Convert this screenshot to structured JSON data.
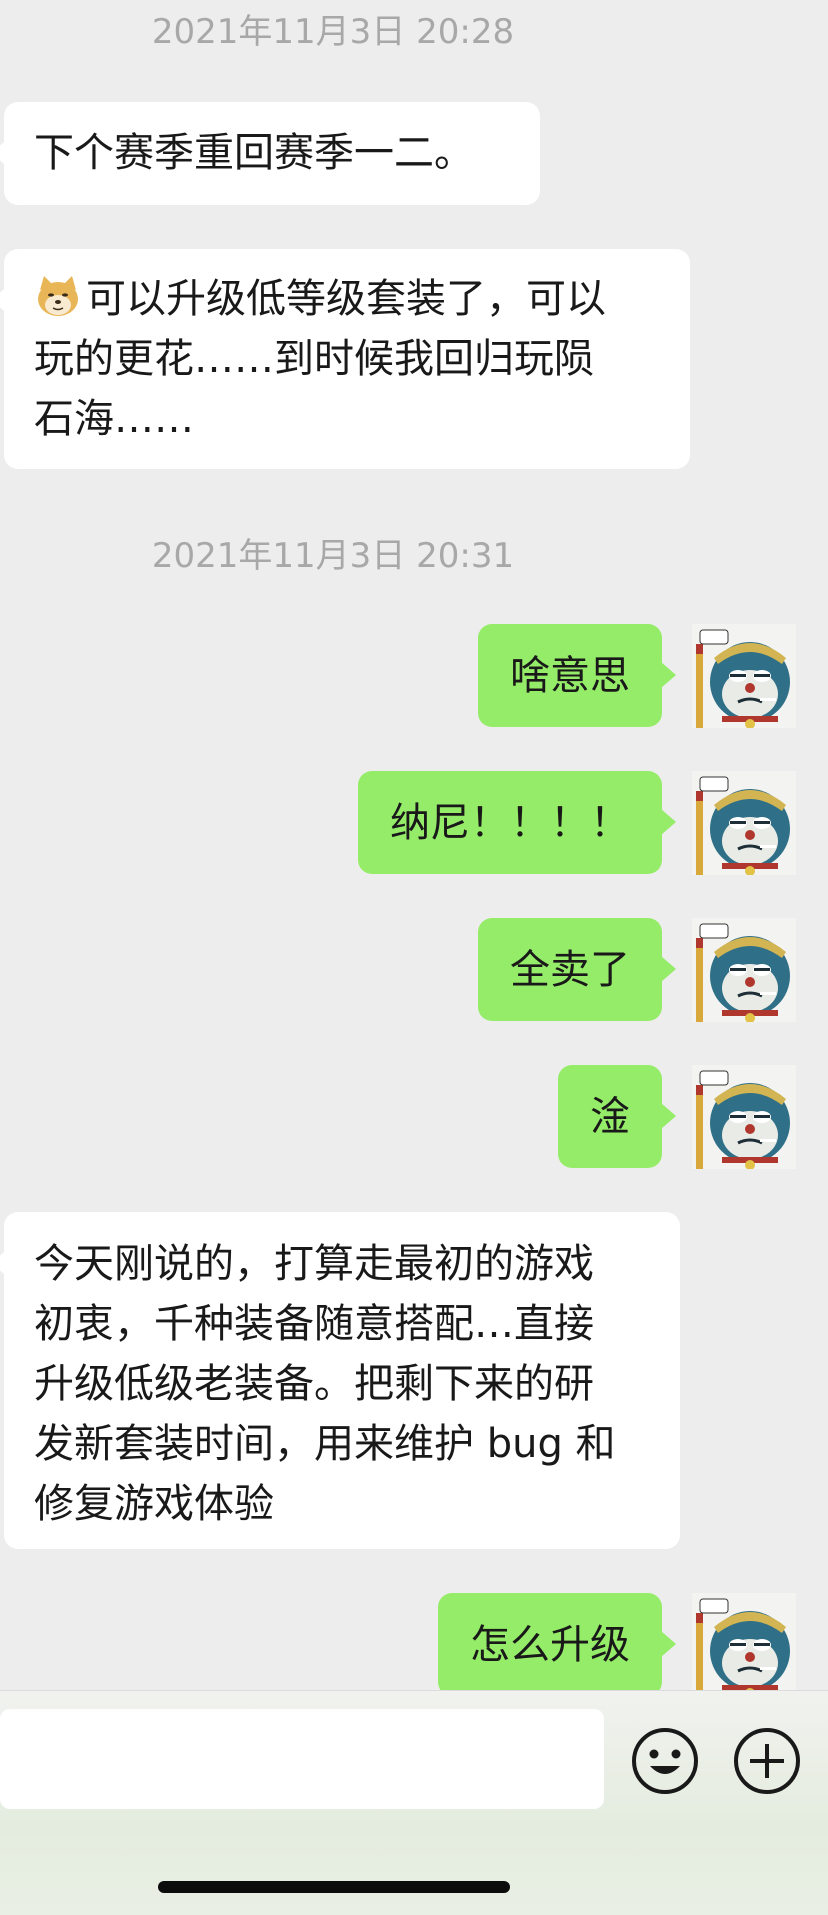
{
  "timestamps": [
    "2021年11月3日 20:28",
    "2021年11月3日 20:31"
  ],
  "messages": [
    {
      "side": "in",
      "text": "下个赛季重回赛季一二。"
    },
    {
      "side": "in",
      "emoji": "doge-emoji",
      "lines": [
        "可以升级低等级套装了，可以",
        "玩的更花……到时候我回归玩陨",
        "石海……"
      ]
    },
    {
      "side": "out",
      "text": "啥意思"
    },
    {
      "side": "out",
      "text": "纳尼！！！！"
    },
    {
      "side": "out",
      "text": "全卖了"
    },
    {
      "side": "out",
      "text": "淦"
    },
    {
      "side": "in",
      "lines": [
        "今天刚说的，打算走最初的游戏",
        "初衷，千种装备随意搭配…直接",
        "升级低级老装备。把剩下来的研",
        "发新套装时间，用来维护 bug 和",
        "修复游戏体验"
      ]
    },
    {
      "side": "out",
      "text": "怎么升级"
    }
  ],
  "input": {
    "value": "",
    "placeholder": ""
  },
  "icons": {
    "emoji_button": "smiley-icon",
    "more_button": "plus-circle-icon",
    "avatar": "cartoon-avatar"
  },
  "colors": {
    "background": "#ededed",
    "outgoing_bubble": "#95ec69",
    "incoming_bubble": "#ffffff",
    "timestamp": "#a8a8a8"
  }
}
